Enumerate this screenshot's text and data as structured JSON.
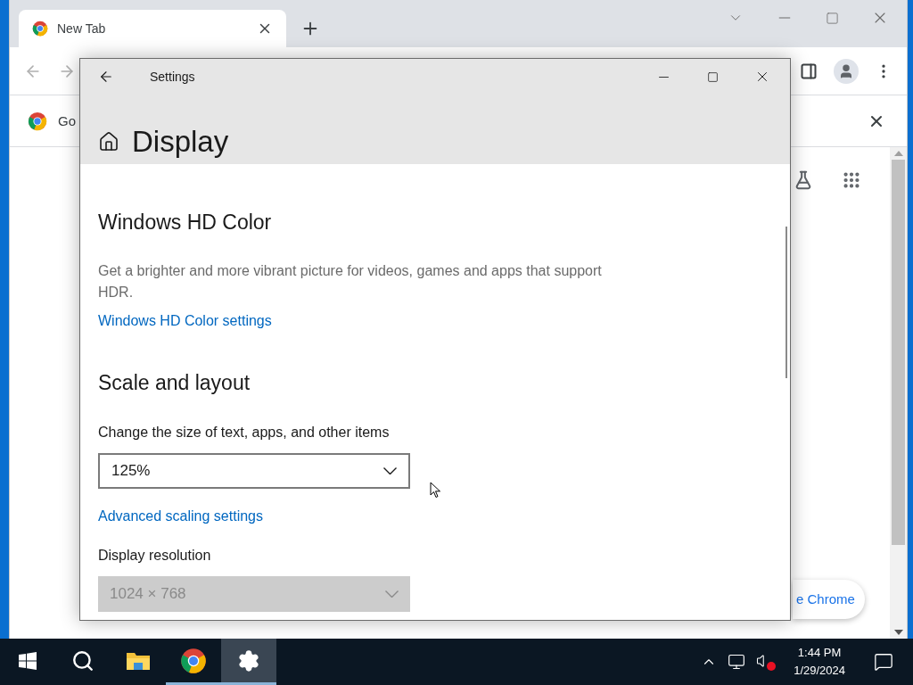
{
  "browser": {
    "tab": {
      "title": "New Tab"
    },
    "info_bar": {
      "text": "Go"
    },
    "promo_button": {
      "label": "e Chrome"
    }
  },
  "settings": {
    "title": "Settings",
    "page_title": "Display",
    "sections": [
      {
        "heading": "Windows HD Color",
        "description": "Get a brighter and more vibrant picture for videos, games and apps that support HDR.",
        "link": "Windows HD Color settings"
      },
      {
        "heading": "Scale and layout",
        "fields": [
          {
            "label": "Change the size of text, apps, and other items",
            "value": "125%",
            "disabled": false,
            "link": "Advanced scaling settings"
          },
          {
            "label": "Display resolution",
            "value": "1024 × 768",
            "disabled": true
          }
        ]
      }
    ]
  },
  "taskbar": {
    "apps": [
      {
        "kind": "start",
        "selected": false,
        "running": false
      },
      {
        "kind": "search",
        "selected": false,
        "running": false
      },
      {
        "kind": "explorer",
        "selected": false,
        "running": false
      },
      {
        "kind": "chrome",
        "selected": false,
        "running": true
      },
      {
        "kind": "settings",
        "selected": true,
        "running": true
      }
    ],
    "time": "1:44 PM",
    "date": "1/29/2024"
  }
}
